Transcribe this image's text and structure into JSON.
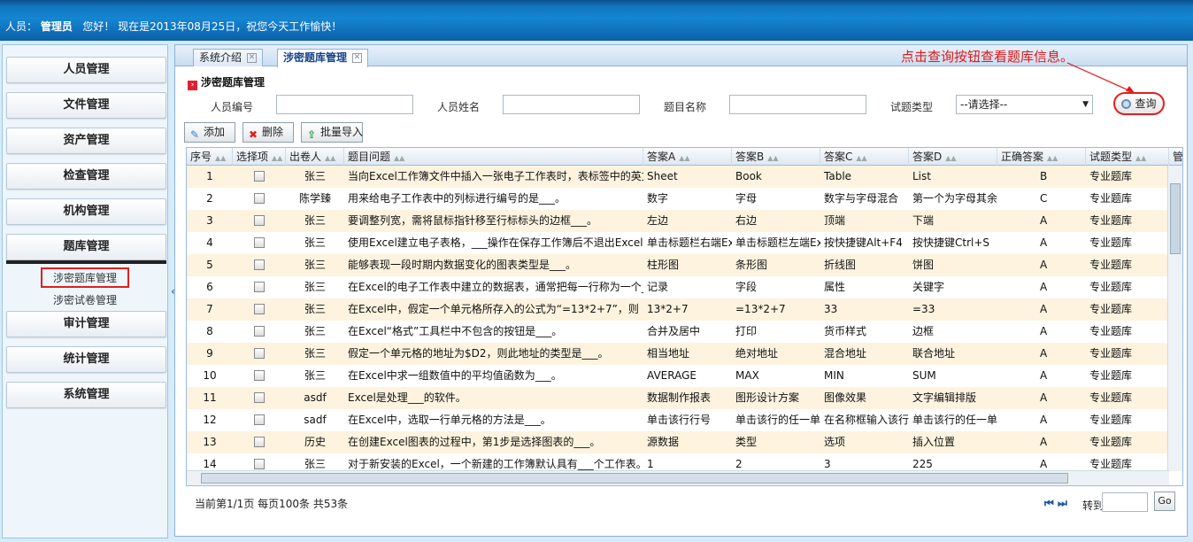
{
  "header": {
    "greeting_prefix": "人员：",
    "user": "管理员",
    "greeting_suffix": "您好！ 现在是2013年08月25日，祝您今天工作愉快！"
  },
  "sidebar": {
    "items": [
      "人员管理",
      "文件管理",
      "资产管理",
      "检查管理",
      "机构管理",
      "题库管理",
      "审计管理",
      "统计管理",
      "系统管理"
    ],
    "subitems": [
      "涉密题库管理",
      "涉密试卷管理"
    ],
    "collapse_glyph": "«"
  },
  "tabs": [
    {
      "label": "系统介绍"
    },
    {
      "label": "涉密题库管理"
    }
  ],
  "panel": {
    "title": "涉密题库管理",
    "hint": "点击查询按钮查看题库信息。"
  },
  "filters": {
    "labels": [
      "人员编号",
      "人员姓名",
      "题目名称",
      "试题类型"
    ],
    "select_value": "--请选择--",
    "query_label": "查询"
  },
  "toolbar": {
    "add": "添加",
    "delete": "删除",
    "import": "批量导入"
  },
  "grid": {
    "columns": [
      "序号",
      "选择项",
      "出卷人",
      "题目问题",
      "答案A",
      "答案B",
      "答案C",
      "答案D",
      "正确答案",
      "试题类型",
      "管"
    ],
    "rows": [
      [
        "1",
        "张三",
        "当向Excel工作簿文件中插入一张电子工作表时，表标签中的英文",
        "Sheet",
        "Book",
        "Table",
        "List",
        "B",
        "专业题库"
      ],
      [
        "2",
        "陈学臻",
        "用来给电子工作表中的列标进行编号的是___。",
        "数字",
        "字母",
        "数字与字母混合",
        "第一个为字母其余",
        "C",
        "专业题库"
      ],
      [
        "3",
        "张三",
        "要调整列宽，需将鼠标指针移至行标标头的边框___。",
        "左边",
        "右边",
        "顶端",
        "下端",
        "A",
        "专业题库"
      ],
      [
        "4",
        "张三",
        "使用Excel建立电子表格，___操作在保存工作簿后不退出Excel。",
        "单击标题栏右端Ex",
        "单击标题栏左端Ex",
        "按快捷键Alt+F4",
        "按快捷键Ctrl+S",
        "A",
        "专业题库"
      ],
      [
        "5",
        "张三",
        "能够表现一段时期内数据变化的图表类型是___。",
        "柱形图",
        "条形图",
        "折线图",
        "饼图",
        "A",
        "专业题库"
      ],
      [
        "6",
        "张三",
        "在Excel的电子工作表中建立的数据表，通常把每一行称为一个_",
        "记录",
        "字段",
        "属性",
        "关键字",
        "A",
        "专业题库"
      ],
      [
        "7",
        "张三",
        "在Excel中，假定一个单元格所存入的公式为“=13*2+7”，则",
        "13*2+7",
        "=13*2+7",
        "33",
        "=33",
        "A",
        "专业题库"
      ],
      [
        "8",
        "张三",
        "在Excel“格式”工具栏中不包含的按钮是___。",
        "合并及居中",
        "打印",
        "货币样式",
        "边框",
        "A",
        "专业题库"
      ],
      [
        "9",
        "张三",
        "假定一个单元格的地址为$D2，则此地址的类型是___。",
        "相当地址",
        "绝对地址",
        "混合地址",
        "联合地址",
        "A",
        "专业题库"
      ],
      [
        "10",
        "张三",
        "在Excel中求一组数值中的平均值函数为___。",
        "AVERAGE",
        "MAX",
        "MIN",
        "SUM",
        "A",
        "专业题库"
      ],
      [
        "11",
        "asdf",
        "Excel是处理___的软件。",
        "数据制作报表",
        "图形设计方案",
        "图像效果",
        "文字编辑排版",
        "A",
        "专业题库"
      ],
      [
        "12",
        "sadf",
        "在Excel中，选取一行单元格的方法是___。",
        "单击该行行号",
        "单击该行的任一单",
        "在名称框输入该行",
        "单击该行的任一单",
        "A",
        "专业题库"
      ],
      [
        "13",
        "历史",
        "在创建Excel图表的过程中，第1步是选择图表的___。",
        "源数据",
        "类型",
        "选项",
        "插入位置",
        "A",
        "专业题库"
      ],
      [
        "14",
        "张三",
        "对于新安装的Excel，一个新建的工作簿默认具有___个工作表。",
        "1",
        "2",
        "3",
        "225",
        "A",
        "专业题库"
      ]
    ]
  },
  "pager": {
    "info": "当前第1/1页  每页100条  共53条",
    "nav": "⏮ ⏭",
    "goto_label": "转到",
    "go_label": "Go"
  }
}
